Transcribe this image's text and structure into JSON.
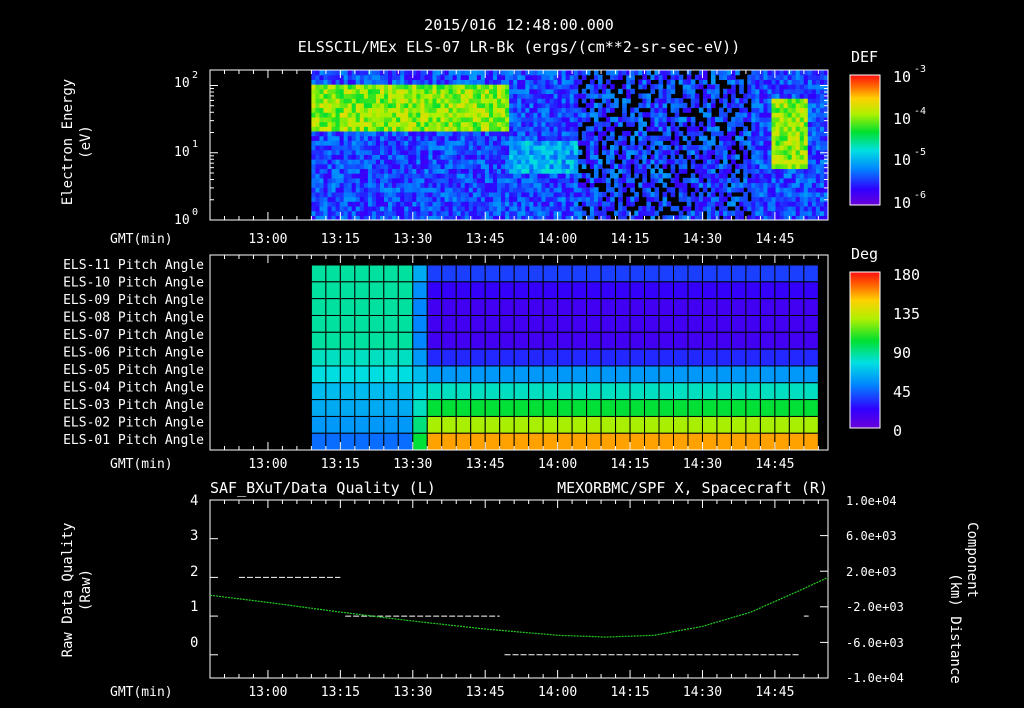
{
  "header": {
    "timestamp": "2015/016 12:48:00.000",
    "subtitle": "ELSSCIL/MEx ELS-07 LR-Bk  (ergs/(cm**2-sr-sec-eV))"
  },
  "time_axis": {
    "label": "GMT(min)",
    "ticks": [
      "13:00",
      "13:15",
      "13:30",
      "13:45",
      "14:00",
      "14:15",
      "14:30",
      "14:45"
    ],
    "tick_minutes": [
      780,
      795,
      810,
      825,
      840,
      855,
      870,
      885
    ],
    "range_minutes": [
      768,
      896
    ]
  },
  "panel1": {
    "ylabel_line1": "Electron Energy",
    "ylabel_line2": "(eV)",
    "yticks": [
      {
        "base": "10",
        "exp": "0",
        "value": 1
      },
      {
        "base": "10",
        "exp": "1",
        "value": 10
      },
      {
        "base": "10",
        "exp": "2",
        "value": 100
      }
    ],
    "colorbar_title": "DEF",
    "colorbar_ticks": [
      {
        "base": "10",
        "exp": "-3",
        "value": 0.001
      },
      {
        "base": "10",
        "exp": "-4",
        "value": 0.0001
      },
      {
        "base": "10",
        "exp": "-5",
        "value": 1e-05
      },
      {
        "base": "10",
        "exp": "-6",
        "value": 1e-06
      }
    ]
  },
  "panel2": {
    "row_labels": [
      "ELS-11 Pitch Angle",
      "ELS-10 Pitch Angle",
      "ELS-09 Pitch Angle",
      "ELS-08 Pitch Angle",
      "ELS-07 Pitch Angle",
      "ELS-06 Pitch Angle",
      "ELS-05 Pitch Angle",
      "ELS-04 Pitch Angle",
      "ELS-03 Pitch Angle",
      "ELS-02 Pitch Angle",
      "ELS-01 Pitch Angle"
    ],
    "colorbar_title": "Deg",
    "colorbar_ticks": [
      "180",
      "135",
      "90",
      "45",
      "0"
    ]
  },
  "panel3": {
    "left_title": "SAF_BXuT/Data Quality (L)",
    "right_title": "MEXORBMC/SPF X, Spacecraft (R)",
    "ylabel_left_line1": "Raw Data Quality",
    "ylabel_left_line2": "(Raw)",
    "ylabel_right_line1": "Component",
    "ylabel_right_line2": "Distance",
    "ylabel_right_line3": "(km)",
    "left_ticks": [
      "4",
      "3",
      "2",
      "1",
      "0"
    ],
    "right_ticks": [
      "1.0e+04",
      "6.0e+03",
      "2.0e+03",
      "-2.0e+03",
      "-6.0e+03",
      "-1.0e+04"
    ],
    "colors": {
      "right_title": "#2ad32a",
      "trace": "#22cc22"
    }
  },
  "chart_data": [
    {
      "type": "heatmap",
      "title": "ELSSCIL/MEx ELS-07 LR-Bk  (ergs/(cm**2-sr-sec-eV))",
      "xlabel": "GMT(min)",
      "ylabel": "Electron Energy (eV)",
      "yscale": "log",
      "ylim": [
        1,
        170
      ],
      "x_range": [
        "12:48",
        "14:56"
      ],
      "data_start": "13:09",
      "colorbar": {
        "label": "DEF",
        "scale": "log",
        "range": [
          1e-06,
          0.001
        ]
      },
      "features": [
        {
          "time_range": [
            "13:09",
            "13:50"
          ],
          "energy_range_eV": [
            20,
            100
          ],
          "level": "1e-4"
        },
        {
          "time_range": [
            "13:50",
            "14:04"
          ],
          "energy_range_eV": [
            5,
            15
          ],
          "level": "1e-5"
        },
        {
          "time_range": [
            "14:04",
            "14:35"
          ],
          "energy_range_eV": [
            1,
            170
          ],
          "level": "1e-6"
        },
        {
          "time_range": [
            "14:44",
            "14:52"
          ],
          "energy_range_eV": [
            6,
            60
          ],
          "level": "1e-4"
        }
      ]
    },
    {
      "type": "heatmap",
      "xlabel": "GMT(min)",
      "rows": [
        "ELS-11",
        "ELS-10",
        "ELS-09",
        "ELS-08",
        "ELS-07",
        "ELS-06",
        "ELS-05",
        "ELS-04",
        "ELS-03",
        "ELS-02",
        "ELS-01"
      ],
      "colorbar": {
        "label": "Deg",
        "range": [
          0,
          180
        ]
      },
      "time_bins": [
        "13:09",
        "13:12",
        "13:15",
        "13:18",
        "13:21",
        "13:24",
        "13:27",
        "13:30",
        "13:33",
        "13:36",
        "13:39",
        "13:42",
        "13:45",
        "13:48",
        "13:51",
        "13:54",
        "13:57",
        "14:00",
        "14:03",
        "14:06",
        "14:09",
        "14:12",
        "14:15",
        "14:18",
        "14:21",
        "14:24",
        "14:27",
        "14:30",
        "14:33",
        "14:36",
        "14:39",
        "14:42",
        "14:45",
        "14:48",
        "14:51"
      ],
      "early_values_deg": [
        85,
        85,
        85,
        85,
        85,
        80,
        75,
        65,
        60,
        55,
        45
      ],
      "late_values_deg": [
        35,
        20,
        15,
        15,
        15,
        30,
        55,
        80,
        100,
        125,
        155
      ]
    },
    {
      "type": "line",
      "xlabel": "GMT(min)",
      "series": [
        {
          "name": "SAF_BXuT/Data Quality (L)",
          "axis": "left",
          "segments": [
            {
              "x": [
                "12:54",
                "13:15"
              ],
              "y": 2
            },
            {
              "x": [
                "13:16",
                "13:48"
              ],
              "y": 1
            },
            {
              "x": [
                "13:49",
                "14:50"
              ],
              "y": 0
            },
            {
              "x": [
                "14:51",
                "14:52"
              ],
              "y": 1
            }
          ],
          "ylim": [
            -0.6,
            4
          ]
        },
        {
          "name": "MEXORBMC/SPF X, Spacecraft (R)",
          "axis": "right",
          "x": [
            "12:48",
            "13:00",
            "13:15",
            "13:30",
            "13:45",
            "14:00",
            "14:10",
            "14:20",
            "14:30",
            "14:40",
            "14:50",
            "14:56"
          ],
          "y": [
            -700,
            -1500,
            -2600,
            -3600,
            -4500,
            -5200,
            -5400,
            -5200,
            -4200,
            -2600,
            -200,
            1300
          ],
          "ylim": [
            -10000,
            10000
          ]
        }
      ]
    }
  ]
}
